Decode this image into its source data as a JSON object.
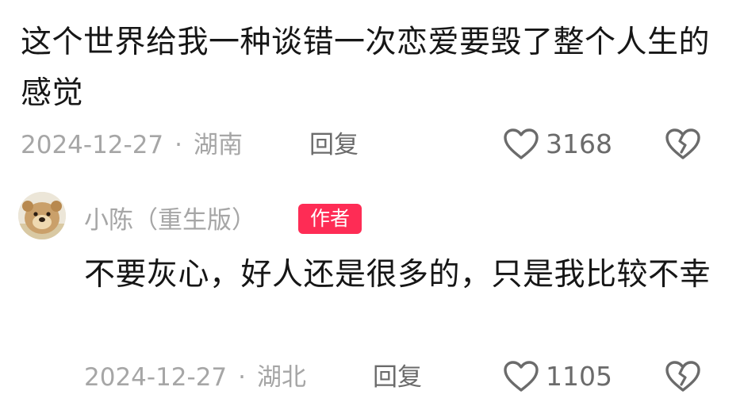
{
  "comment": {
    "text": "这个世界给我一种谈错一次恋爱要毁了整个人生的感觉",
    "date": "2024-12-27",
    "location": "湖南",
    "reply_label": "回复",
    "like_count": "3168"
  },
  "reply_comment": {
    "username": "小陈（重生版）",
    "badge": "作者",
    "text": "不要灰心，好人还是很多的，只是我比较不幸",
    "date": "2024-12-27",
    "location": "湖北",
    "reply_label": "回复",
    "like_count": "1105"
  },
  "meta_separator": "·",
  "icons": {
    "like": "heart-outline-icon",
    "dislike": "broken-heart-icon"
  },
  "colors": {
    "badge": "#fe2c55",
    "meta_text": "#a6a6a6",
    "action_text": "#6b6b6b",
    "body_text": "#161616"
  }
}
